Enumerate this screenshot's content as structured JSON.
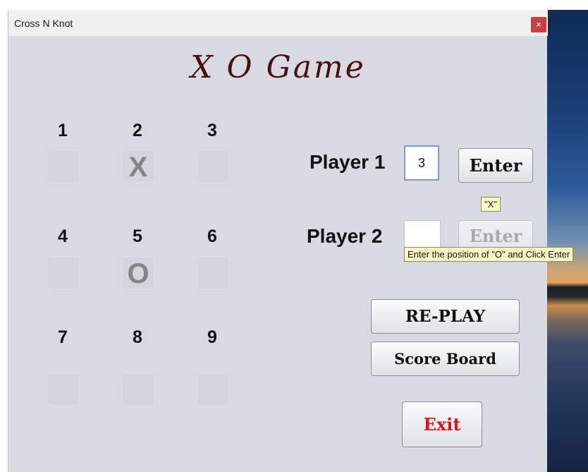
{
  "window": {
    "title": "Cross N Knot",
    "close_glyph": "×"
  },
  "game": {
    "title": "X O Game"
  },
  "board": {
    "cells": [
      {
        "number": "1",
        "mark": ""
      },
      {
        "number": "2",
        "mark": "X"
      },
      {
        "number": "3",
        "mark": ""
      },
      {
        "number": "4",
        "mark": ""
      },
      {
        "number": "5",
        "mark": "O"
      },
      {
        "number": "6",
        "mark": ""
      },
      {
        "number": "7",
        "mark": ""
      },
      {
        "number": "8",
        "mark": ""
      },
      {
        "number": "9",
        "mark": ""
      }
    ]
  },
  "player1": {
    "label": "Player 1",
    "input_value": "3",
    "enter_label": "Enter",
    "hint": "\"X\""
  },
  "player2": {
    "label": "Player 2",
    "input_value": "",
    "enter_label": "Enter",
    "tooltip": "Enter the position of \"O\" and Click Enter"
  },
  "buttons": {
    "replay": "RE-PLAY",
    "score_board": "Score Board",
    "exit": "Exit"
  },
  "colors": {
    "title": "#4a0d0d",
    "exit": "#e0141b",
    "close": "#c9403f",
    "window_bg": "#d8dae1"
  }
}
